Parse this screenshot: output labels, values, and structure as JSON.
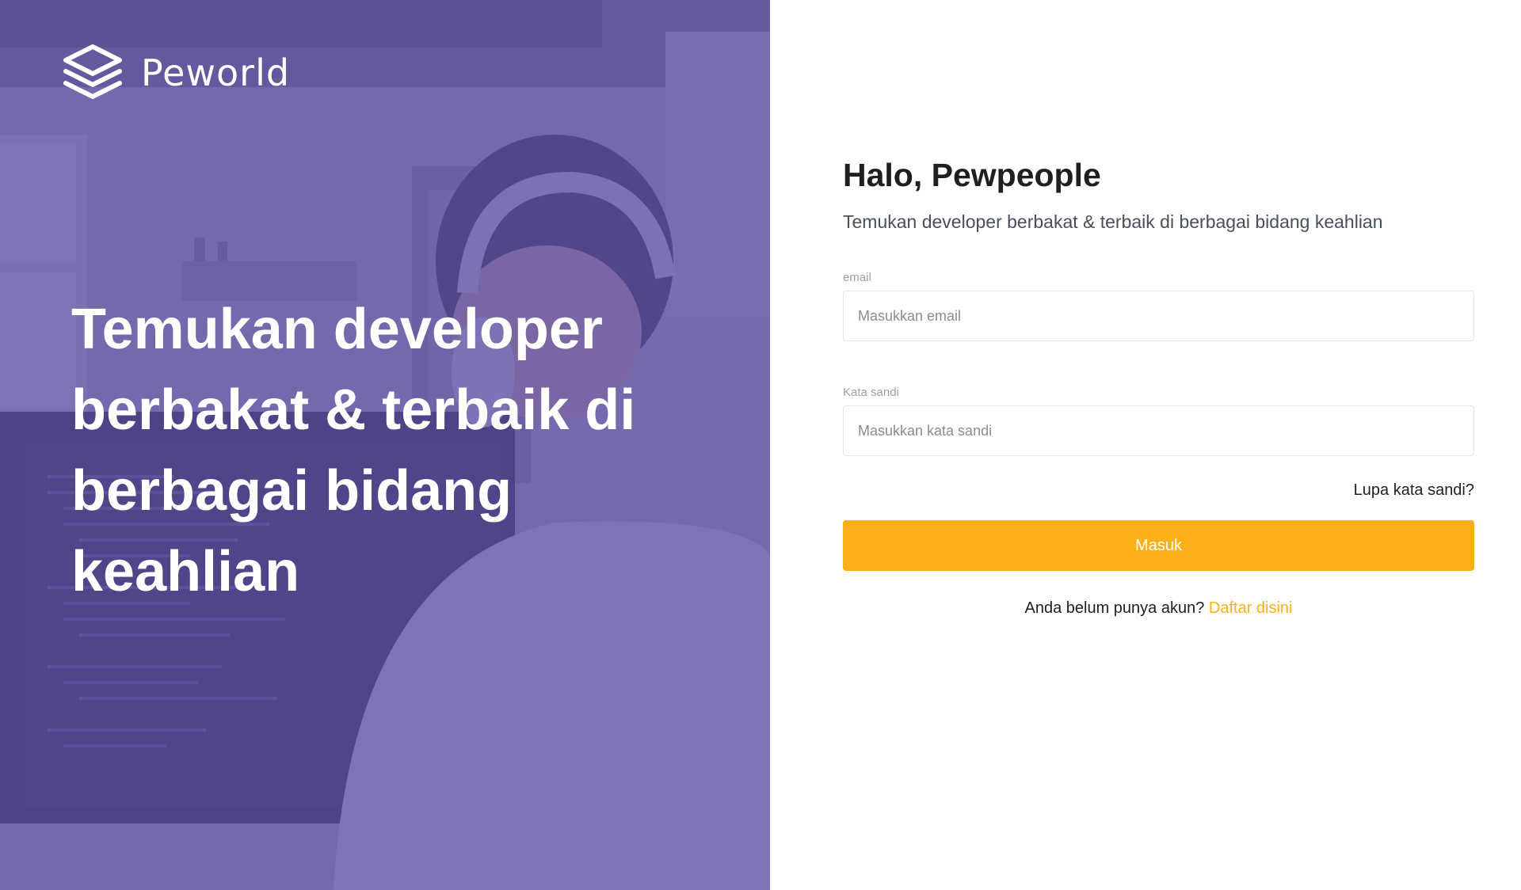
{
  "brand": {
    "name": "Peworld",
    "logo_icon": "layers-icon",
    "primary_color": "#5e50a1",
    "accent_color": "#fbb017"
  },
  "hero": {
    "heading": "Temukan developer berbakat & terbaik di berbagai bidang keahlian",
    "background": "developer-wearing-headphones-at-monitor-photo"
  },
  "login": {
    "greeting": "Halo, Pewpeople",
    "subtitle": "Temukan developer berbakat & terbaik di berbagai bidang keahlian",
    "email_label": "email",
    "email_placeholder": "Masukkan email",
    "email_value": "",
    "password_label": "Kata sandi",
    "password_placeholder": "Masukkan kata sandi",
    "password_value": "",
    "forgot_label": "Lupa kata sandi?",
    "submit_label": "Masuk",
    "signup_prompt": "Anda belum punya akun?",
    "signup_link_label": "Daftar disini"
  }
}
